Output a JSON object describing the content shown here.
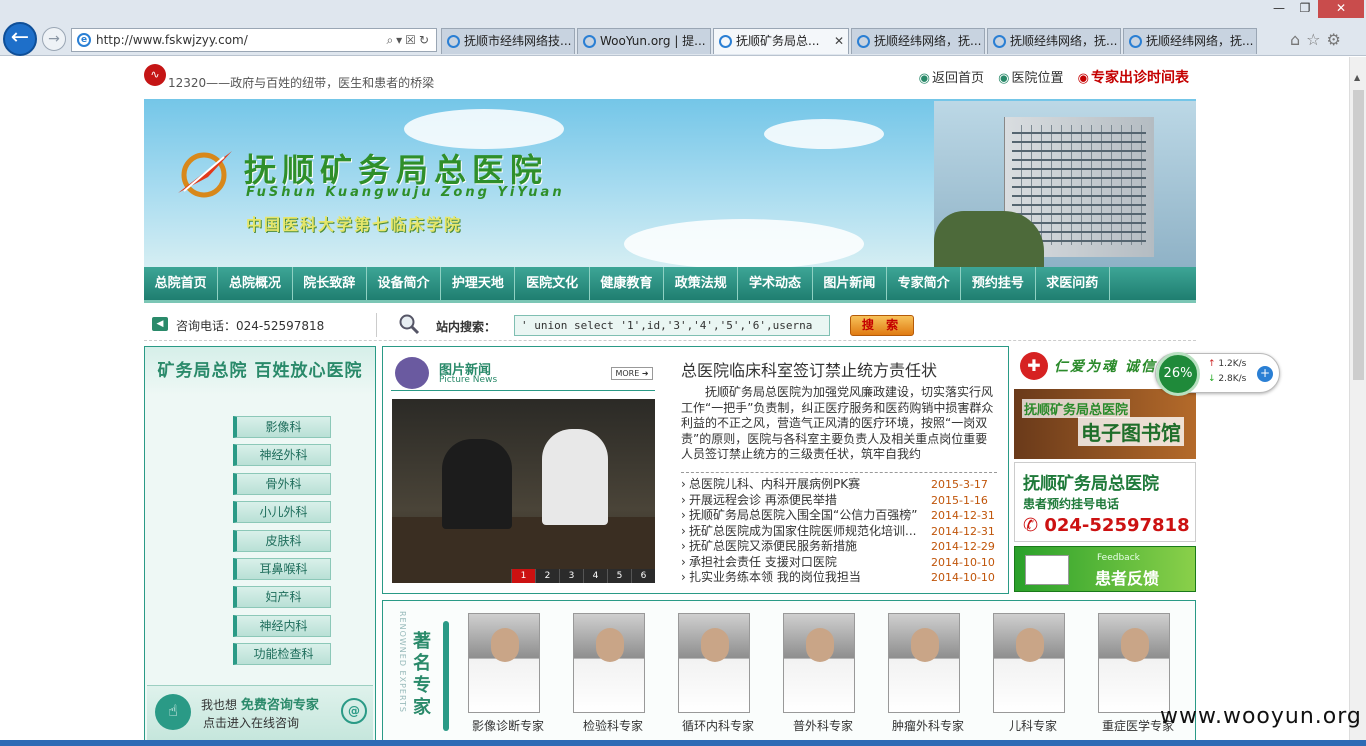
{
  "browser": {
    "address": "http://www.fskwjzyy.com/",
    "tabs": [
      {
        "label": "抚顺市经纬网络技..."
      },
      {
        "label": "WooYun.org | 提..."
      },
      {
        "label": "抚顺矿务局总..."
      },
      {
        "label": "抚顺经纬网络，抚..."
      },
      {
        "label": "抚顺经纬网络，抚..."
      },
      {
        "label": "抚顺经纬网络，抚..."
      }
    ]
  },
  "top": {
    "slogan": "12320——政府与百姓的纽带，医生和患者的桥梁",
    "links": [
      "返回首页",
      "医院位置",
      "专家出诊时间表"
    ]
  },
  "banner": {
    "title": "抚顺矿务局总医院",
    "pinyin": "FuShun Kuangwuju Zong YiYuan",
    "subtitle": "中国医科大学第七临床学院"
  },
  "nav": [
    "总院首页",
    "总院概况",
    "院长致辞",
    "设备简介",
    "护理天地",
    "医院文化",
    "健康教育",
    "政策法规",
    "学术动态",
    "图片新闻",
    "专家简介",
    "预约挂号",
    "求医问药"
  ],
  "searchbar": {
    "phone_label": "咨询电话：024-52597818",
    "search_label": "站内搜索：",
    "search_value": "' union select '1',id,'3','4','5','6',userna",
    "search_button": "搜 索"
  },
  "left": {
    "title": "矿务局总院 百姓放心医院",
    "departments": [
      "影像科",
      "神经外科",
      "骨外科",
      "小儿外科",
      "皮肤科",
      "耳鼻喉科",
      "妇产科",
      "神经内科",
      "功能检查科"
    ],
    "consult_line1_prefix": "我也想",
    "consult_line1_bold": "免费咨询专家",
    "consult_line2": "点击进入在线咨询"
  },
  "picnews": {
    "title": "图片新闻",
    "subtitle": "Picture News",
    "more": "MORE",
    "pages": [
      "1",
      "2",
      "3",
      "4",
      "5",
      "6"
    ]
  },
  "news": {
    "headline": "总医院临床科室签订禁止统方责任状",
    "body": "抚顺矿务局总医院为加强党风廉政建设，切实落实行风工作“一把手”负责制，纠正医疗服务和医药购销中损害群众利益的不正之风，营造气正风清的医疗环境，按照“一岗双责”的原则，医院与各科室主要负责人及相关重点岗位重要人员签订禁止统方的三级责任状，筑牢自我约",
    "items": [
      {
        "title": "总医院儿科、内科开展病例PK赛",
        "date": "2015-3-17"
      },
      {
        "title": "开展远程会诊 再添便民举措",
        "date": "2015-1-16"
      },
      {
        "title": "抚顺矿务局总医院入围全国“公信力百强榜”",
        "date": "2014-12-31"
      },
      {
        "title": "抚矿总医院成为国家住院医师规范化培训...",
        "date": "2014-12-31"
      },
      {
        "title": "抚矿总医院又添便民服务新措施",
        "date": "2014-12-29"
      },
      {
        "title": "承担社会责任 支援对口医院",
        "date": "2014-10-10"
      },
      {
        "title": "扎实业务练本领 我的岗位我担当",
        "date": "2014-10-10"
      }
    ]
  },
  "right": {
    "brand": "仁爱为魂 诚信",
    "library_l1": "抚顺矿务局总医院",
    "library_l2": "电子图书馆",
    "appt_l1": "抚顺矿务局总医院",
    "appt_l2": "患者预约挂号电话",
    "appt_l3": "024-52597818",
    "feedback_en": "Feedback",
    "feedback": "患者反馈"
  },
  "experts": {
    "vertical_en": "RENOWNED EXPERTS",
    "title": "著名专家",
    "list": [
      "影像诊断专家",
      "检验科专家",
      "循环内科专家",
      "普外科专家",
      "肿瘤外科专家",
      "儿科专家",
      "重症医学专家"
    ]
  },
  "widget": {
    "percent": "26%",
    "up": "1.2K/s",
    "down": "2.8K/s"
  },
  "watermark": "www.wooyun.org"
}
